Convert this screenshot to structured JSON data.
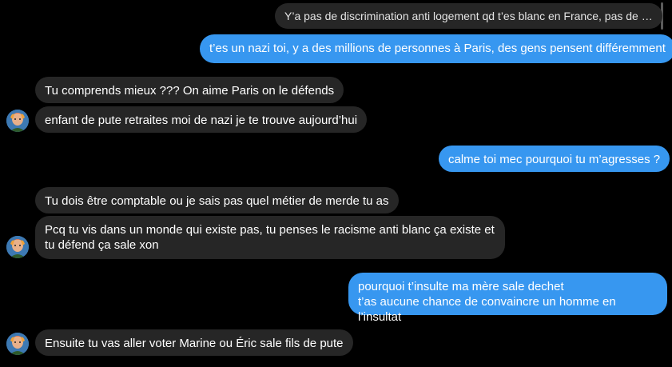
{
  "conversation": {
    "messages": [
      {
        "id": "m1",
        "sender": "self",
        "kind": "quoted_reply",
        "text": "Y’a pas de discrimination anti logement qd t’es blanc en France, pas de …"
      },
      {
        "id": "m2",
        "sender": "self",
        "kind": "text",
        "text": "t’es un nazi toi, y a des millions de personnes à Paris, des gens pensent différemment"
      },
      {
        "id": "m3",
        "sender": "other",
        "kind": "text",
        "text": "Tu comprends mieux ??? On aime Paris on le défends"
      },
      {
        "id": "m4",
        "sender": "other",
        "kind": "text",
        "text": "enfant de pute retraites moi de nazi je te trouve aujourd’hui"
      },
      {
        "id": "m5",
        "sender": "self",
        "kind": "text",
        "text": "calme toi mec pourquoi tu m’agresses ?"
      },
      {
        "id": "m6",
        "sender": "other",
        "kind": "text",
        "text": "Tu dois être comptable ou je sais pas quel métier de merde tu as"
      },
      {
        "id": "m7",
        "sender": "other",
        "kind": "text",
        "lines": [
          "Pcq tu vis dans un monde qui existe pas, tu penses le racisme anti blanc ça existe et",
          "tu défend ça sale xon"
        ]
      },
      {
        "id": "m8",
        "sender": "self",
        "kind": "text",
        "lines": [
          "pourquoi t’insulte ma mère sale dechet",
          "t’as aucune chance de convaincre un homme en l’insultat"
        ]
      },
      {
        "id": "m9",
        "sender": "other",
        "kind": "text",
        "text": "Ensuite tu vas aller voter Marine ou Éric sale fils de pute"
      }
    ]
  },
  "colors": {
    "background": "#000000",
    "outgoing_bubble": "#3797f0",
    "incoming_bubble": "#262626",
    "text": "#ffffff"
  },
  "icons": {
    "avatar": "contact-avatar-icon"
  }
}
